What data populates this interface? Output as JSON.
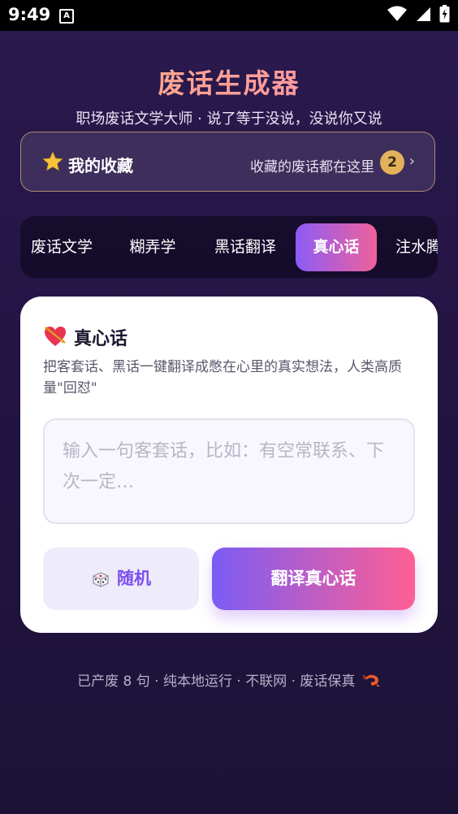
{
  "status": {
    "time": "9:49",
    "notification_letter": "A"
  },
  "app": {
    "title": "废话生成器",
    "subtitle": "职场废话文学大师 · 说了等于没说，没说你又说"
  },
  "favorites": {
    "title": "我的收藏",
    "description": "收藏的废话都在这里",
    "count": "2",
    "chevron": "›"
  },
  "tabs": [
    {
      "label": "废话文学"
    },
    {
      "label": "糊弄学"
    },
    {
      "label": "黑话翻译"
    },
    {
      "label": "真心话",
      "active": true
    },
    {
      "label": "注水腾"
    }
  ],
  "card": {
    "icon": "heart-arrow-icon",
    "title": "真心话",
    "description": "把客套话、黑话一键翻译成憋在心里的真实想法，人类高质量\"回怼\"",
    "input_placeholder": "输入一句客套话，比如：有空常联系、下次一定…",
    "random_label": "随机",
    "translate_label": "翻译真心话"
  },
  "footer": {
    "text": "已产废 8 句 · 纯本地运行 · 不联网 · 废话保真",
    "icon": "shrimp-icon"
  },
  "colors": {
    "accent_purple": "#8b5cf6",
    "accent_pink": "#f0619a",
    "badge_gold": "#e2b15a"
  }
}
